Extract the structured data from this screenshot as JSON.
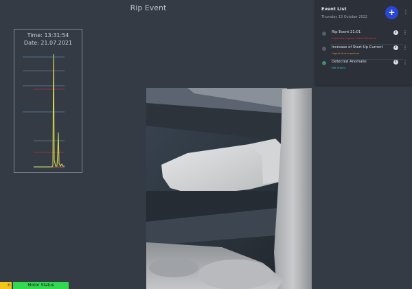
{
  "page": {
    "title": "Rip Event"
  },
  "sensor": {
    "time": "Time: 13:31:54",
    "date": "Date: 21.07.2021"
  },
  "event_list": {
    "title": "Event List",
    "date": "Thursday 13 October 2022",
    "add_button": "+",
    "items": [
      {
        "title": "Rip Event 21:01",
        "status": "Extremely Urgent, Critical Situation",
        "status_color": "#e0353a",
        "completed": false
      },
      {
        "title": "Increase of Start-Up Current",
        "status": "Urgent And Important",
        "status_color": "#e58a2a",
        "completed": false
      },
      {
        "title": "Detected Anomalie",
        "status": "Not Urgent",
        "status_color": "#2fc3c9",
        "completed": true
      }
    ]
  },
  "status_bar": {
    "left_chip": "n",
    "motor_status": "Motor Status"
  },
  "colors": {
    "accent": "#2a46d8",
    "motor_status_bg": "#32d84f",
    "left_chip_bg": "#f2c61c"
  }
}
